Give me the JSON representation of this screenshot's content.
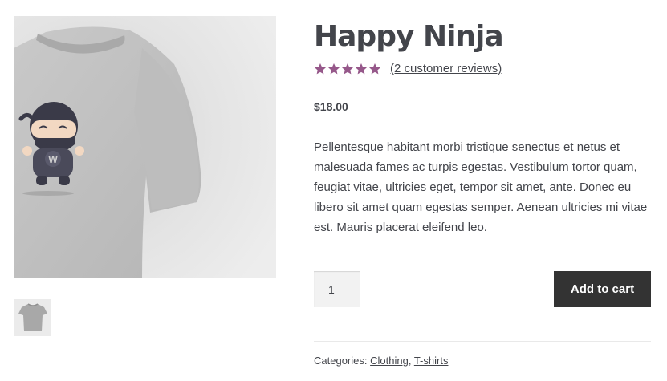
{
  "product": {
    "title": "Happy Ninja",
    "rating": {
      "stars_filled": 5,
      "stars_total": 5,
      "reviews_link": "(2 customer reviews)"
    },
    "price": "$18.00",
    "description": "Pellentesque habitant morbi tristique senectus et netus et malesuada fames ac turpis egestas. Vestibulum tortor quam, feugiat vitae, ultricies eget, tempor sit amet, ante. Donec eu libero sit amet quam egestas semper. Aenean ultricies mi vitae est. Mauris placerat eleifend leo.",
    "quantity": "1",
    "add_to_cart_label": "Add to cart",
    "meta": {
      "categories_label": "Categories:",
      "categories": [
        "Clothing",
        "T-shirts"
      ],
      "separator": ","
    }
  },
  "image": {
    "logo_letter": "W"
  },
  "colors": {
    "star": "#96588a",
    "button_bg": "#333333",
    "text": "#43454b"
  }
}
